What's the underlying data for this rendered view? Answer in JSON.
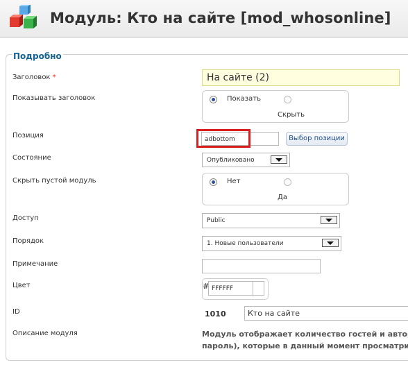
{
  "header": {
    "title": "Модуль: Кто на сайте [mod_whosonline]",
    "logo_icon": "colored-cubes-icon"
  },
  "form": {
    "legend": "Подробно",
    "title_label": "Заголовок",
    "required_mark": "*",
    "title_value": "На сайте (2)",
    "show_title": {
      "label": "Показывать заголовок",
      "options": [
        "Показать",
        "Скрыть"
      ],
      "selected": "Показать"
    },
    "position": {
      "label": "Позиция",
      "value": "adbottom",
      "button": "Выбор позиции"
    },
    "state": {
      "label": "Состояние",
      "value": "Опубликовано"
    },
    "hide_empty": {
      "label": "Скрыть пустой модуль",
      "options": [
        "Нет",
        "Да"
      ],
      "selected": "Нет"
    },
    "access": {
      "label": "Доступ",
      "value": "Public"
    },
    "order": {
      "label": "Порядок",
      "value": "1. Новые пользователи"
    },
    "note": {
      "label": "Примечание",
      "value": ""
    },
    "color": {
      "label": "Цвет",
      "hash": "#",
      "value": "FFFFFF"
    },
    "id": {
      "label": "ID",
      "value": "1010",
      "name": "Кто на сайте"
    },
    "description": {
      "label": "Описание модуля",
      "line1": "Модуль отображает количество гостей и авторизо",
      "line2": "пароль), которые в данный момент просматриваю"
    }
  },
  "colors": {
    "legend": "#146295",
    "required": "#ee2211",
    "highlight": "#d71f1f",
    "title_field_bg": "#ffffe0"
  }
}
